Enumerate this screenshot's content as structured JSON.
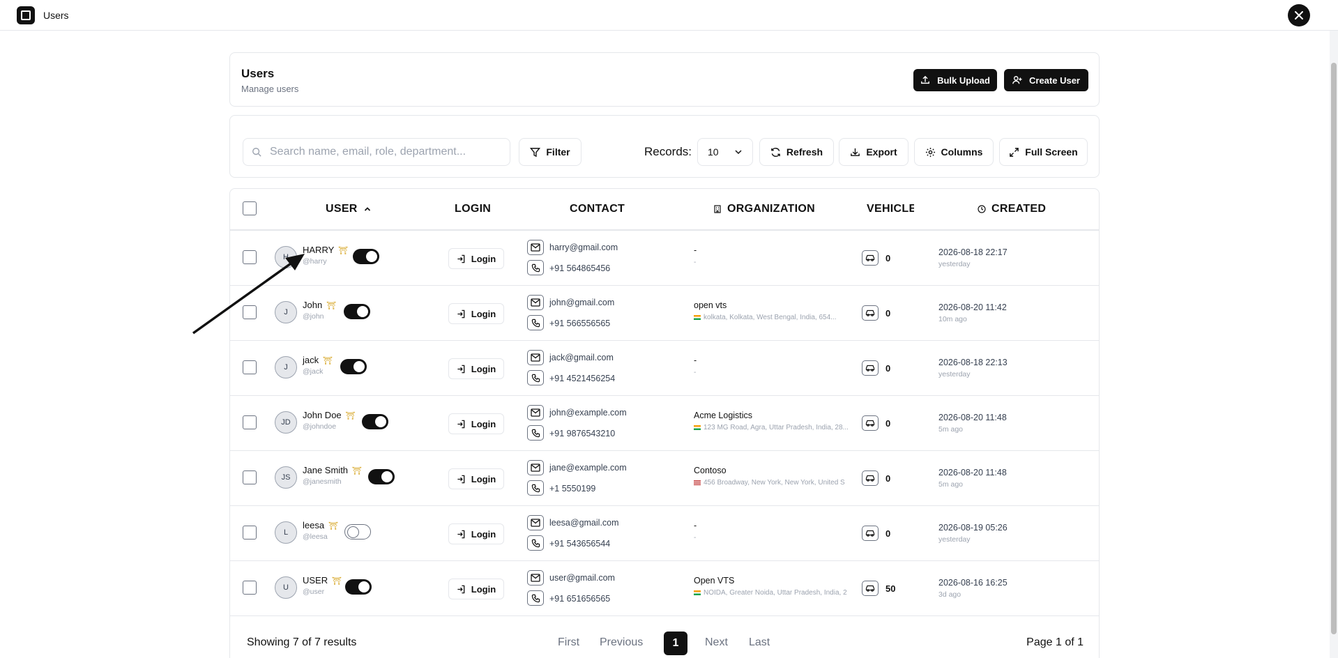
{
  "window": {
    "title": "Users"
  },
  "header": {
    "title": "Users",
    "subtitle": "Manage users",
    "bulk_upload_label": "Bulk Upload",
    "create_user_label": "Create User"
  },
  "toolbar": {
    "search_placeholder": "Search name, email, role, department...",
    "filter_label": "Filter",
    "records_label": "Records:",
    "records_value": "10",
    "refresh_label": "Refresh",
    "export_label": "Export",
    "columns_label": "Columns",
    "fullscreen_label": "Full Screen"
  },
  "table": {
    "columns": {
      "user": "USER",
      "login": "LOGIN",
      "contact": "CONTACT",
      "organization": "ORGANIZATION",
      "vehicle": "VEHICLE",
      "created": "CREATED"
    },
    "login_button_label": "Login",
    "rows": [
      {
        "initials": "H",
        "name": "HARRY",
        "handle": "@harry",
        "active": true,
        "email": "harry@gmail.com",
        "phone": "+91 564865456",
        "org": "-",
        "address": "-",
        "flag": "",
        "vehicles": "0",
        "created": "2026-08-18 22:17",
        "created_rel": "yesterday"
      },
      {
        "initials": "J",
        "name": "John",
        "handle": "@john",
        "active": true,
        "email": "john@gmail.com",
        "phone": "+91 566556565",
        "org": "open vts",
        "address": "kolkata, Kolkata, West Bengal, India, 654...",
        "flag": "in",
        "vehicles": "0",
        "created": "2026-08-20 11:42",
        "created_rel": "10m ago"
      },
      {
        "initials": "J",
        "name": "jack",
        "handle": "@jack",
        "active": true,
        "email": "jack@gmail.com",
        "phone": "+91 4521456254",
        "org": "-",
        "address": "-",
        "flag": "",
        "vehicles": "0",
        "created": "2026-08-18 22:13",
        "created_rel": "yesterday"
      },
      {
        "initials": "JD",
        "name": "John Doe",
        "handle": "@johndoe",
        "active": true,
        "email": "john@example.com",
        "phone": "+91 9876543210",
        "org": "Acme Logistics",
        "address": "123 MG Road, Agra, Uttar Pradesh, India, 28...",
        "flag": "in",
        "vehicles": "0",
        "created": "2026-08-20 11:48",
        "created_rel": "5m ago"
      },
      {
        "initials": "JS",
        "name": "Jane Smith",
        "handle": "@janesmith",
        "active": true,
        "email": "jane@example.com",
        "phone": "+1 5550199",
        "org": "Contoso",
        "address": "456 Broadway, New York, New York, United S",
        "flag": "us",
        "vehicles": "0",
        "created": "2026-08-20 11:48",
        "created_rel": "5m ago"
      },
      {
        "initials": "L",
        "name": "leesa",
        "handle": "@leesa",
        "active": false,
        "email": "leesa@gmail.com",
        "phone": "+91 543656544",
        "org": "-",
        "address": "-",
        "flag": "",
        "vehicles": "0",
        "created": "2026-08-19 05:26",
        "created_rel": "yesterday"
      },
      {
        "initials": "U",
        "name": "USER",
        "handle": "@user",
        "active": true,
        "email": "user@gmail.com",
        "phone": "+91 651656565",
        "org": "Open VTS",
        "address": "NOIDA, Greater Noida, Uttar Pradesh, India, 2",
        "flag": "in",
        "vehicles": "50",
        "created": "2026-08-16 16:25",
        "created_rel": "3d ago"
      }
    ]
  },
  "pagination": {
    "showing": "Showing 7 of 7 results",
    "first": "First",
    "previous": "Previous",
    "current": "1",
    "next": "Next",
    "last": "Last",
    "page_info": "Page 1 of 1"
  }
}
